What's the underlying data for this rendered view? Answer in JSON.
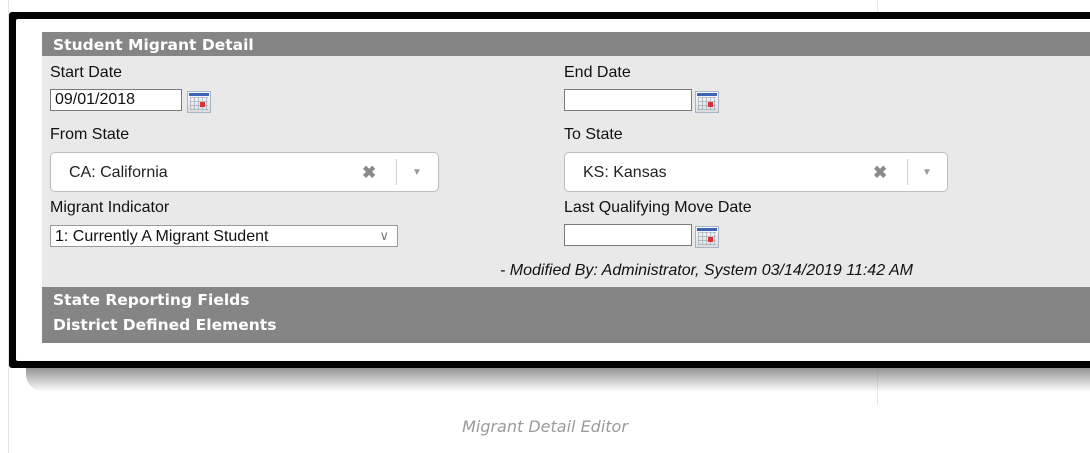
{
  "panel": {
    "title": "Student Migrant Detail",
    "start_date": {
      "label": "Start Date",
      "value": "09/01/2018"
    },
    "end_date": {
      "label": "End Date",
      "value": ""
    },
    "from_state": {
      "label": "From State",
      "value": "CA: California"
    },
    "to_state": {
      "label": "To State",
      "value": "KS: Kansas"
    },
    "migrant_indicator": {
      "label": "Migrant Indicator",
      "value": "1: Currently A Migrant Student"
    },
    "last_qualifying_move_date": {
      "label": "Last Qualifying Move Date",
      "value": ""
    },
    "modified_by": "- Modified By: Administrator, System 03/14/2019 11:42 AM",
    "sections": [
      "State Reporting Fields",
      "District Defined Elements"
    ]
  },
  "icons": {
    "calendar": "calendar-icon",
    "clear": "clear-x-icon",
    "dropdown": "chevron-down-icon"
  },
  "caption": "Migrant Detail Editor",
  "colors": {
    "header_bar": "#858585",
    "panel_bg": "#e9e9e9",
    "frame": "#000000",
    "caption_text": "#9a9a9a",
    "calendar_accent": "#3d63b5",
    "calendar_mark": "#d93232"
  }
}
